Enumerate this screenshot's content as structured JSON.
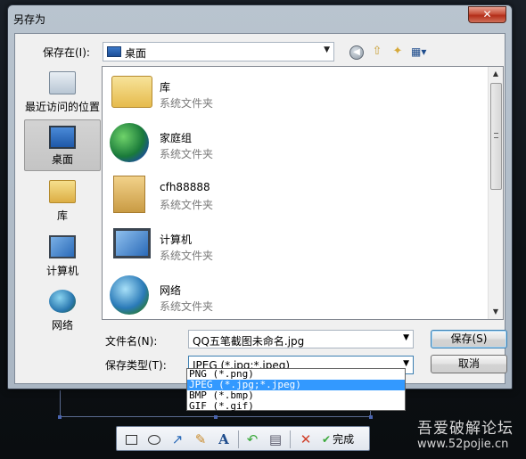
{
  "window": {
    "title": "另存为",
    "close_label": "✕"
  },
  "save_in": {
    "label": "保存在(I):",
    "value": "桌面"
  },
  "places": [
    {
      "label": "最近访问的位置",
      "icon": "recent-places-icon"
    },
    {
      "label": "桌面",
      "icon": "desktop-icon"
    },
    {
      "label": "库",
      "icon": "library-icon"
    },
    {
      "label": "计算机",
      "icon": "computer-icon"
    },
    {
      "label": "网络",
      "icon": "network-icon"
    }
  ],
  "files": [
    {
      "name": "库",
      "type": "系统文件夹",
      "icon": "library-folder-icon"
    },
    {
      "name": "家庭组",
      "type": "系统文件夹",
      "icon": "homegroup-icon"
    },
    {
      "name": "cfh88888",
      "type": "系统文件夹",
      "icon": "user-folder-icon"
    },
    {
      "name": "计算机",
      "type": "系统文件夹",
      "icon": "computer-icon"
    },
    {
      "name": "网络",
      "type": "系统文件夹",
      "icon": "network-icon"
    }
  ],
  "filename": {
    "label": "文件名(N):",
    "value": "QQ五笔截图未命名.jpg"
  },
  "filetype": {
    "label": "保存类型(T):",
    "value": "JPEG (*.jpg;*.jpeg)",
    "options": [
      "PNG (*.png)",
      "JPEG (*.jpg;*.jpeg)",
      "BMP (*.bmp)",
      "GIF (*.gif)"
    ],
    "selected_index": 1
  },
  "buttons": {
    "save": "保存(S)",
    "cancel": "取消"
  },
  "toolbar": {
    "done_label": "完成"
  },
  "watermark": {
    "title": "吾爱破解论坛",
    "url": "www.52pojie.cn"
  },
  "colors": {
    "selection": "#3399ff",
    "dialog_frame": "#aab6c3",
    "background": "#0e1216"
  }
}
